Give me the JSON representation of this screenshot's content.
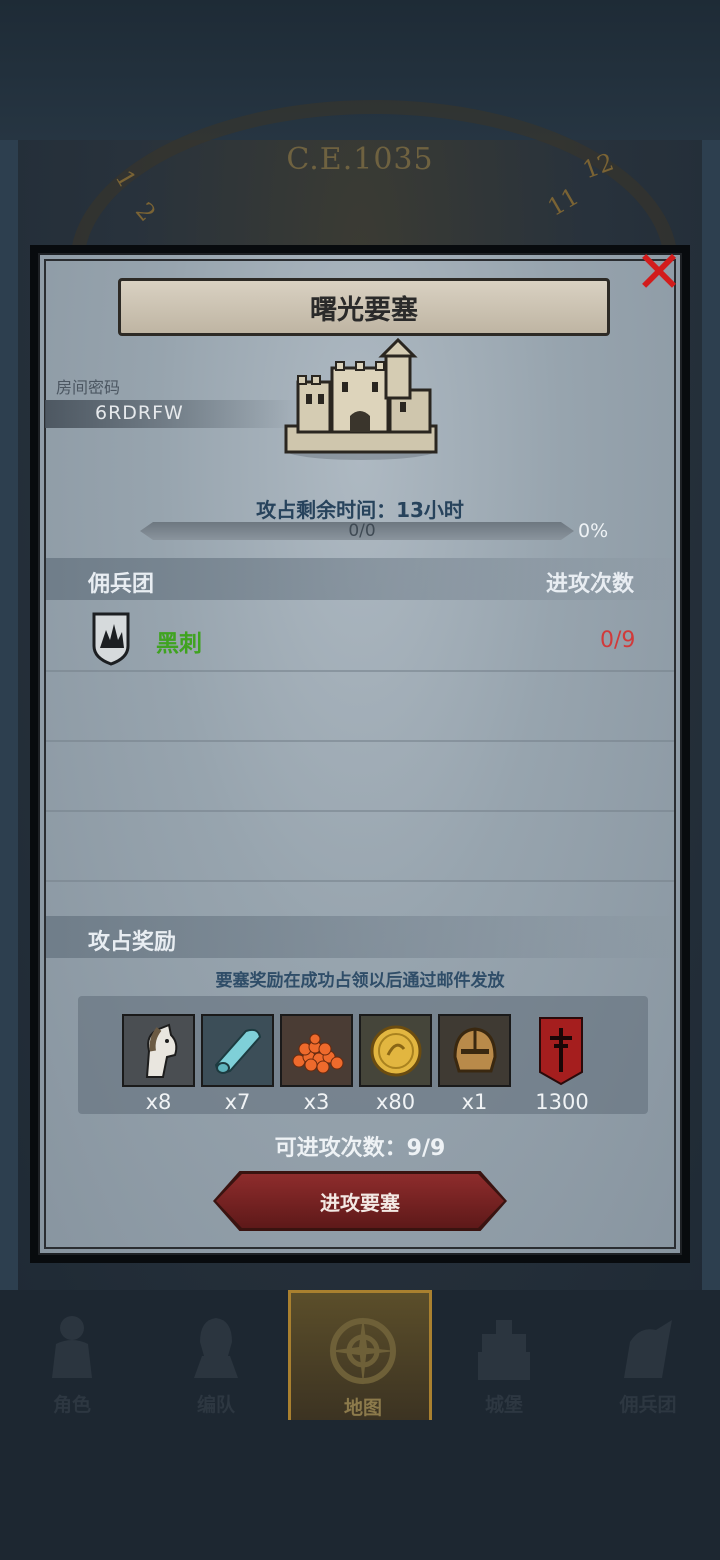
{
  "background": {
    "era": "C.E.1035",
    "clock_numbers": [
      "11",
      "12",
      "1",
      "2"
    ]
  },
  "dialog": {
    "title": "曙光要塞",
    "room_label": "房间密码",
    "room_code": "6RDRFW",
    "time_left": "攻占剩余时间：13小时",
    "progress": {
      "text": "0/0",
      "percent": "0%",
      "fill_fraction": 0
    },
    "mercenary_section": {
      "title": "佣兵团",
      "attack_col": "进攻次数"
    },
    "mercenaries": [
      {
        "name": "黑刺",
        "attacks": "0/9"
      }
    ],
    "reward_section": {
      "title": "攻占奖励",
      "note": "要塞奖励在成功占领以后通过邮件发放",
      "items": [
        {
          "icon": "horse-icon",
          "count": "x8"
        },
        {
          "icon": "cloth-icon",
          "count": "x7"
        },
        {
          "icon": "grain-icon",
          "count": "x3"
        },
        {
          "icon": "gold-coin-icon",
          "count": "x80"
        },
        {
          "icon": "helmet-icon",
          "count": "x1"
        },
        {
          "icon": "banner-icon",
          "count": "1300"
        }
      ]
    },
    "attempts": "可进攻次数：9/9",
    "attack_button": "进攻要塞",
    "close_icon": "close-icon"
  },
  "nav": {
    "items": [
      {
        "label": "角色",
        "icon": "knight-icon",
        "active": false
      },
      {
        "label": "编队",
        "icon": "squad-icon",
        "active": false
      },
      {
        "label": "地图",
        "icon": "compass-icon",
        "active": true
      },
      {
        "label": "城堡",
        "icon": "castle-icon",
        "active": false
      },
      {
        "label": "佣兵团",
        "icon": "mercenary-icon",
        "active": false
      }
    ]
  },
  "colors": {
    "accent_gold": "#a9802f",
    "danger_red": "#d13a3a",
    "merc_green": "#3fa320",
    "button_red": "#8e2c2c"
  }
}
